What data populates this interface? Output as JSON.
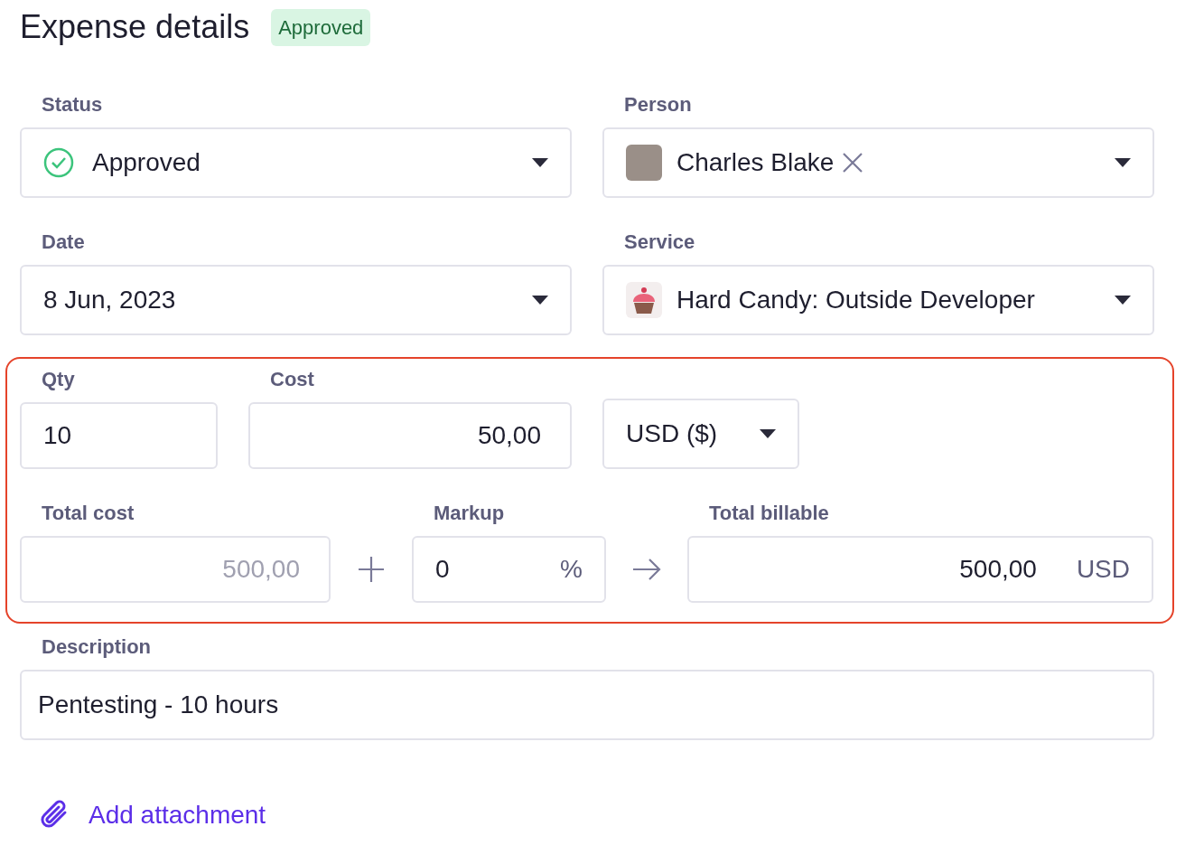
{
  "title": "Expense details",
  "badge": {
    "text": "Approved"
  },
  "status": {
    "label": "Status",
    "value": "Approved"
  },
  "person": {
    "label": "Person",
    "value": "Charles Blake"
  },
  "date": {
    "label": "Date",
    "value": "8 Jun, 2023"
  },
  "service": {
    "label": "Service",
    "value": "Hard Candy: Outside Developer"
  },
  "qty": {
    "label": "Qty",
    "value": "10"
  },
  "cost": {
    "label": "Cost",
    "value": "50,00"
  },
  "currency": {
    "value": "USD ($)"
  },
  "total_cost": {
    "label": "Total cost",
    "value": "500,00",
    "disabled": true
  },
  "markup": {
    "label": "Markup",
    "value": "0",
    "suffix": "%"
  },
  "total_billable": {
    "label": "Total billable",
    "value": "500,00",
    "suffix": "USD"
  },
  "description": {
    "label": "Description",
    "value": "Pentesting - 10 hours"
  },
  "attachment_link": "Add attachment"
}
